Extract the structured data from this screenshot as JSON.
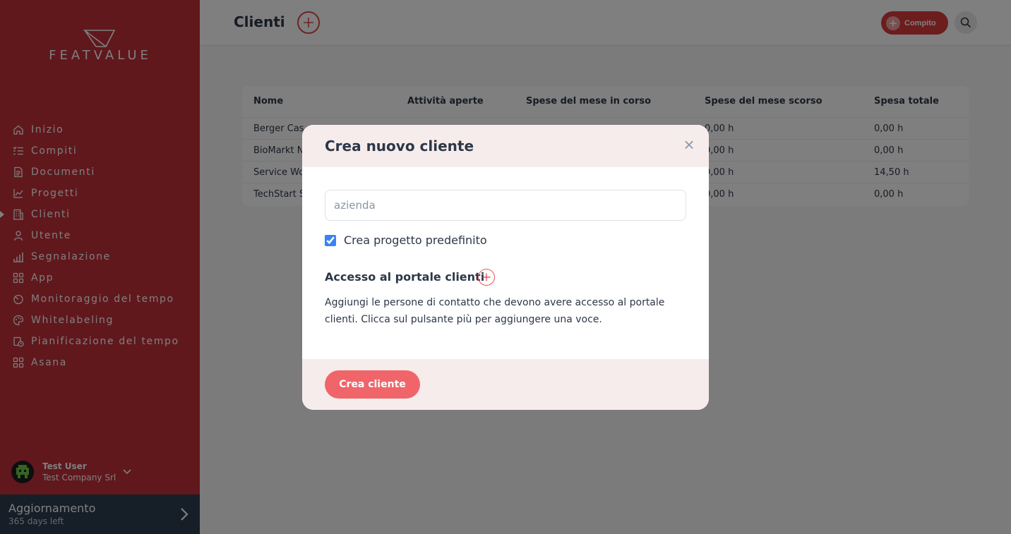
{
  "brand": {
    "logo_text": "FEATVALUE",
    "primary": "#c0303a",
    "accent": "#f0656a"
  },
  "sidebar": {
    "items": [
      {
        "label": "Inizio",
        "icon": "home-icon"
      },
      {
        "label": "Compiti",
        "icon": "list-icon"
      },
      {
        "label": "Documenti",
        "icon": "document-icon"
      },
      {
        "label": "Progetti",
        "icon": "chart-icon"
      },
      {
        "label": "Clienti",
        "icon": "building-icon",
        "active": true
      },
      {
        "label": "Utente",
        "icon": "user-icon"
      },
      {
        "label": "Segnalazione",
        "icon": "bar-chart-icon"
      },
      {
        "label": "App",
        "icon": "apps-icon"
      },
      {
        "label": "Monitoraggio del tempo",
        "icon": "timer-icon"
      },
      {
        "label": "Whitelabeling",
        "icon": "palette-icon"
      },
      {
        "label": "Pianificazione del tempo",
        "icon": "calendar-clock-icon"
      },
      {
        "label": "Asana",
        "icon": "apps-icon"
      }
    ],
    "user": {
      "name": "Test User",
      "company": "Test Company Srl"
    },
    "upgrade": {
      "title": "Aggiornamento",
      "subtitle": "365 days left"
    }
  },
  "header": {
    "title": "Clienti",
    "task_label": "Compito"
  },
  "table": {
    "columns": [
      "Nome",
      "Attività aperte",
      "Spese del mese in corso",
      "Spese del mese scorso",
      "Spesa totale"
    ],
    "rows": [
      {
        "name": "Berger Cas",
        "last_month": "0,00 h",
        "total": "0,00 h"
      },
      {
        "name": "BioMarkt N",
        "last_month": "0,00 h",
        "total": "0,00 h"
      },
      {
        "name": "Service Wo",
        "last_month": "0,00 h",
        "total": "14,50 h"
      },
      {
        "name": "TechStart S",
        "last_month": "0,00 h",
        "total": "0,00 h"
      }
    ]
  },
  "modal": {
    "title": "Crea nuovo cliente",
    "close_label": "×",
    "company_placeholder": "azienda",
    "company_value": "",
    "default_project_label": "Crea progetto predefinito",
    "default_project_checked": true,
    "portal_title": "Accesso al portale clienti",
    "portal_description": "Aggiungi le persone di contatto che devono avere accesso al portale clienti. Clicca sul pulsante più per aggiungere una voce.",
    "submit_label": "Crea cliente"
  }
}
